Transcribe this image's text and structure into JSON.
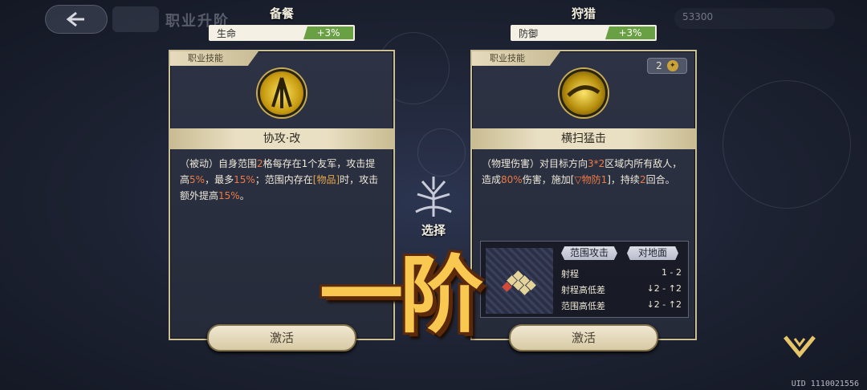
{
  "top_bar": {
    "page_title": "职业升阶",
    "currency_value": "53300"
  },
  "left": {
    "title": "备餐",
    "stat_label": "生命",
    "stat_bonus": "+3%",
    "card_tab": "职业技能",
    "skill_icon": "sword-emblem-icon",
    "skill_name": "协攻·改",
    "desc": {
      "p1": "（被动）自身范围",
      "v1": "2",
      "p2": "格每存在1个友军，攻击提高",
      "v2": "5%",
      "p3": "，最多",
      "v3": "15%",
      "p4": "；范围内存在",
      "item": "[物品]",
      "p5": "时，攻击额外提高",
      "v4": "15%",
      "p6": "。"
    },
    "activate_label": "激活"
  },
  "right": {
    "title": "狩猎",
    "stat_label": "防御",
    "stat_bonus": "+3%",
    "card_tab": "职业技能",
    "badge_count": "2",
    "skill_icon": "sweep-slash-icon",
    "skill_name": "横扫猛击",
    "desc": {
      "p1": "（物理伤害）对目标方向",
      "v1": "3*2",
      "p2": "区域内所有敌人，造成",
      "v2": "80%",
      "p3": "伤害，施加[",
      "debuff": "▽物防1",
      "p4": "]，持续",
      "v3": "2",
      "p5": "回合。"
    },
    "range": {
      "tag1": "范围攻击",
      "tag2": "对地面",
      "rows": [
        {
          "label": "射程",
          "value": "1 - 2"
        },
        {
          "label": "射程高低差",
          "value": "↓2 - ↑2"
        },
        {
          "label": "范围高低差",
          "value": "↓2 - ↑2"
        }
      ]
    },
    "activate_label": "激活"
  },
  "middle": {
    "choose_label": "选择",
    "choose_icon": "tree-emblem-icon"
  },
  "overlay": {
    "big_text": "一阶"
  },
  "footer": {
    "uid": "UID 1110021556",
    "confirm_icon": "chevron-down-icon"
  },
  "colors": {
    "accent_orange": "#ee7a46",
    "bonus_green": "#6aa044",
    "card_border": "#cbbf98"
  }
}
